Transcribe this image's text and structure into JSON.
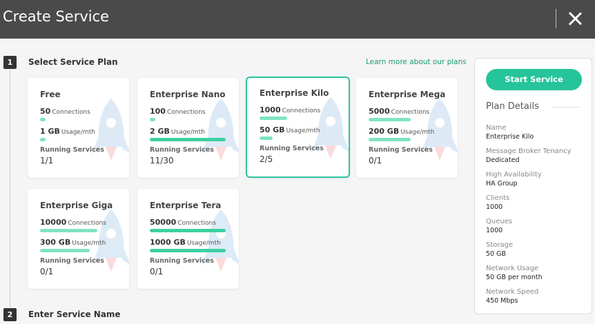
{
  "header": {
    "title": "Create Service"
  },
  "steps": [
    {
      "num": "1",
      "label": "Select Service Plan"
    },
    {
      "num": "2",
      "label": "Enter Service Name"
    }
  ],
  "learn_more": "Learn more about our plans",
  "plans": [
    {
      "name": "Free",
      "connections": "50",
      "connections_unit": "Connections",
      "connections_fill": 0.05,
      "storage": "1 GB",
      "storage_unit": "Usage/mth",
      "storage_fill": 0.05,
      "rs_label": "Running Services",
      "rs_value": "1/1"
    },
    {
      "name": "Enterprise Nano",
      "connections": "100",
      "connections_unit": "Connections",
      "connections_fill": 0.02,
      "storage": "2 GB",
      "storage_unit": "Usage/mth",
      "storage_fill": 1.0,
      "rs_label": "Running Services",
      "rs_value": "11/30"
    },
    {
      "name": "Enterprise Kilo",
      "connections": "1000",
      "connections_unit": "Connections",
      "connections_fill": 0.36,
      "storage": "50 GB",
      "storage_unit": "Usage/mth",
      "storage_fill": 0.17,
      "rs_label": "Running Services",
      "rs_value": "2/5",
      "selected": true
    },
    {
      "name": "Enterprise Mega",
      "connections": "5000",
      "connections_unit": "Connections",
      "connections_fill": 0.55,
      "storage": "200 GB",
      "storage_unit": "Usage/mth",
      "storage_fill": 0.55,
      "rs_label": "Running Services",
      "rs_value": "0/1"
    },
    {
      "name": "Enterprise Giga",
      "connections": "10000",
      "connections_unit": "Connections",
      "connections_fill": 0.75,
      "storage": "300 GB",
      "storage_unit": "Usage/mth",
      "storage_fill": 0.65,
      "rs_label": "Running Services",
      "rs_value": "0/1"
    },
    {
      "name": "Enterprise Tera",
      "connections": "50000",
      "connections_unit": "Connections",
      "connections_fill": 1.0,
      "storage": "1000 GB",
      "storage_unit": "Usage/mth",
      "storage_fill": 1.0,
      "rs_label": "Running Services",
      "rs_value": "0/1"
    }
  ],
  "panel": {
    "start_button": "Start Service",
    "title": "Plan Details",
    "details": [
      {
        "key": "Name",
        "value": "Enterprise Kilo"
      },
      {
        "key": "Message Broker Tenancy",
        "value": "Dedicated"
      },
      {
        "key": "High Availability",
        "value": "HA Group"
      },
      {
        "key": "Clients",
        "value": "1000"
      },
      {
        "key": "Queues",
        "value": "1000"
      },
      {
        "key": "Storage",
        "value": "50 GB"
      },
      {
        "key": "Network Usage",
        "value": "50 GB per month"
      },
      {
        "key": "Network Speed",
        "value": "450 Mbps"
      }
    ]
  },
  "colors": {
    "accent": "#26c49a",
    "header": "#4a4a4a",
    "bar_light": "#7fe3c4",
    "bar_full": "#3dd0a2"
  }
}
